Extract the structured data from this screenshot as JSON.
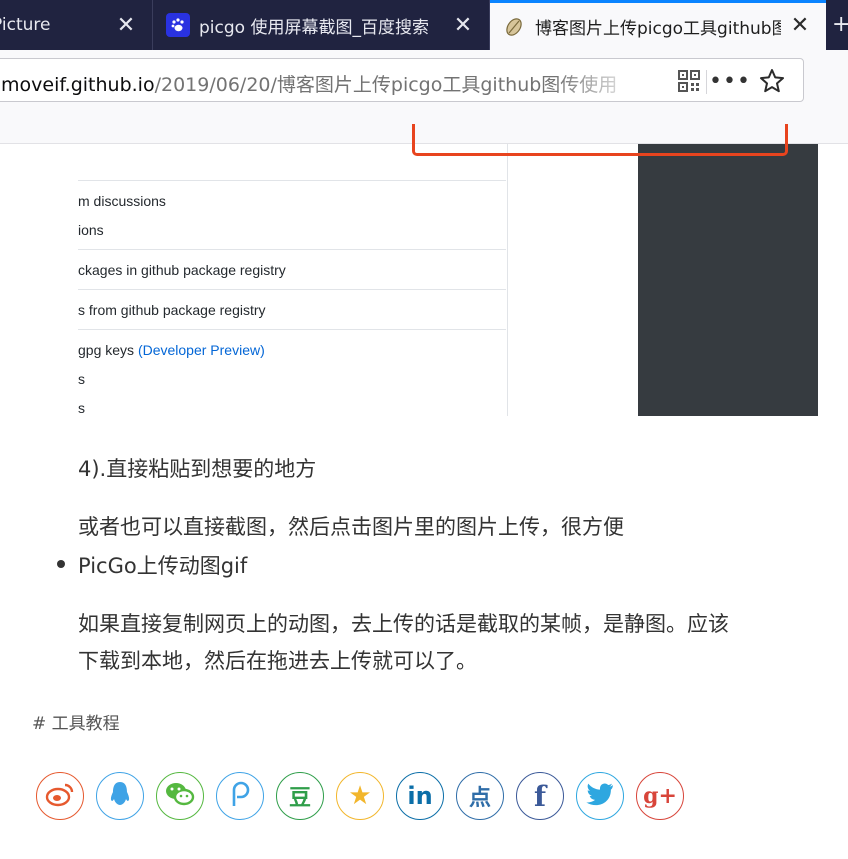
{
  "tabs": [
    {
      "title": "Picture",
      "active": false
    },
    {
      "title": "picgo 使用屏幕截图_百度搜索",
      "active": false
    },
    {
      "title": "博客图片上传picgo工具github图传使用",
      "active": true
    }
  ],
  "newtab_label": "+",
  "urlbar": {
    "host": "moveif.github.io",
    "path": "/2019/06/20/博客图片上传picgo工具github图传使用"
  },
  "screenshot_rows": [
    {
      "text": "m discussions"
    },
    {
      "text": "ions"
    },
    {
      "text": "ckages in github package registry"
    },
    {
      "text": "s from github package registry"
    },
    {
      "text": "gpg keys ",
      "link": "(Developer Preview)"
    },
    {
      "text": "s"
    },
    {
      "text": "s"
    }
  ],
  "article": {
    "step4": "4).直接粘贴到想要的地方",
    "alt_screenshot": "或者也可以直接截图，然后点击图片里的图片上传，很方便",
    "bullet_gif": "PicGo上传动图gif",
    "gif_line1": "如果直接复制网页上的动图，去上传的话是截取的某帧，是静图。应该",
    "gif_line2": "下载到本地，然后在拖进去上传就可以了。"
  },
  "tag": "# 工具教程",
  "share_buttons": [
    {
      "name": "weibo",
      "glyph": "微",
      "color": "#e6592e"
    },
    {
      "name": "qq",
      "glyph": "Q",
      "color": "#3fa3e6"
    },
    {
      "name": "wechat",
      "glyph": "微",
      "color": "#55b840"
    },
    {
      "name": "qzone",
      "glyph": "P",
      "color": "#3fa3e6"
    },
    {
      "name": "douban",
      "glyph": "豆",
      "color": "#2f9e4a"
    },
    {
      "name": "qq-favorites",
      "glyph": "★",
      "color": "#f2b62c"
    },
    {
      "name": "linkedin",
      "glyph": "in",
      "color": "#0b6ea8"
    },
    {
      "name": "diandian",
      "glyph": "点",
      "color": "#2f6da8"
    },
    {
      "name": "facebook",
      "glyph": "f",
      "color": "#3b5998"
    },
    {
      "name": "twitter",
      "glyph": "t",
      "color": "#2ea7e0"
    },
    {
      "name": "google-plus",
      "glyph": "g+",
      "color": "#d8453a"
    }
  ]
}
